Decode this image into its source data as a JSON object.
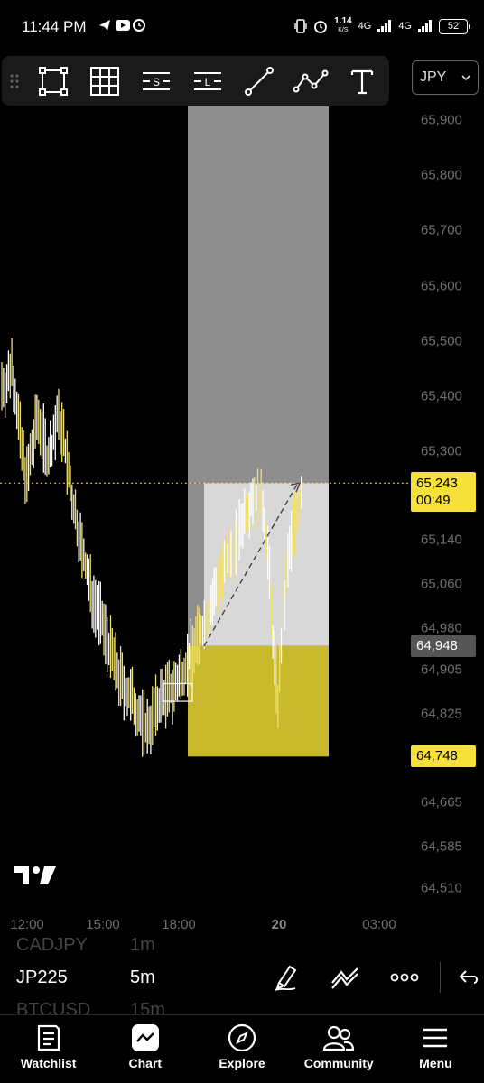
{
  "status_bar": {
    "time": "11:44 PM",
    "net_speed_value": "1.14",
    "net_speed_unit": "K/S",
    "signal_1": "4G",
    "signal_2": "4G",
    "battery": "52"
  },
  "toolbar": {
    "tools": [
      {
        "name": "rectangle-tool-icon",
        "label": ""
      },
      {
        "name": "grid-tool-icon",
        "label": ""
      },
      {
        "name": "short-position-tool-icon",
        "label": "S"
      },
      {
        "name": "long-position-tool-icon",
        "label": "L"
      },
      {
        "name": "trend-line-tool-icon",
        "label": ""
      },
      {
        "name": "path-tool-icon",
        "label": ""
      },
      {
        "name": "text-tool-icon",
        "label": ""
      }
    ],
    "currency": "JPY"
  },
  "price_axis": {
    "ticks": [
      "65,900",
      "65,800",
      "65,700",
      "65,600",
      "65,500",
      "65,400",
      "65,300",
      "65,140",
      "65,060",
      "64,980",
      "64,905",
      "64,825",
      "64,665",
      "64,585",
      "64,510"
    ],
    "current_price": "65,243",
    "countdown": "00:49",
    "entry_price": "64,948",
    "stop_price": "64,748"
  },
  "time_axis": {
    "ticks": [
      "12:00",
      "15:00",
      "18:00",
      "20",
      "03:00"
    ]
  },
  "symbols": {
    "previous": {
      "symbol": "CADJPY",
      "interval": "1m"
    },
    "current": {
      "symbol": "JP225",
      "interval": "5m"
    },
    "next": {
      "symbol": "BTCUSD",
      "interval": "15m"
    }
  },
  "bottom_nav": [
    {
      "name": "watchlist",
      "label": "Watchlist"
    },
    {
      "name": "chart",
      "label": "Chart"
    },
    {
      "name": "explore",
      "label": "Explore"
    },
    {
      "name": "community",
      "label": "Community"
    },
    {
      "name": "menu",
      "label": "Menu"
    }
  ],
  "colors": {
    "accent_yellow": "#f5e13a",
    "stop_zone": "#c9b92d",
    "target_zone": "#d8d8d8",
    "target_upper_zone": "#8e8e8e",
    "candle_up": "#ffffff",
    "candle_down": "#f0e06a"
  },
  "chart_data": {
    "type": "candlestick",
    "symbol": "JP225",
    "interval": "5m",
    "y_range": [
      64470,
      65950
    ],
    "x_labels": [
      "12:00",
      "15:00",
      "18:00",
      "20",
      "03:00"
    ],
    "close_series": [
      65420,
      65460,
      65380,
      65300,
      65250,
      65300,
      65360,
      65340,
      65290,
      65310,
      65360,
      65340,
      65280,
      65210,
      65170,
      65120,
      65080,
      65040,
      65020,
      64990,
      64960,
      64930,
      64900,
      64880,
      64860,
      64850,
      64830,
      64810,
      64800,
      64820,
      64840,
      64860,
      64860,
      64870,
      64880,
      64900,
      64920,
      64940,
      64960,
      64980,
      65000,
      65030,
      65060,
      65080,
      65100,
      65120,
      65140,
      65180,
      65200,
      65220,
      65210,
      65200,
      65120,
      64960,
      64850,
      65000,
      65100,
      65160,
      65200,
      65243
    ],
    "position": {
      "direction": "long",
      "entry": 64948,
      "stop": 64748,
      "target": 65243,
      "upper_zone_top": 65950
    }
  }
}
